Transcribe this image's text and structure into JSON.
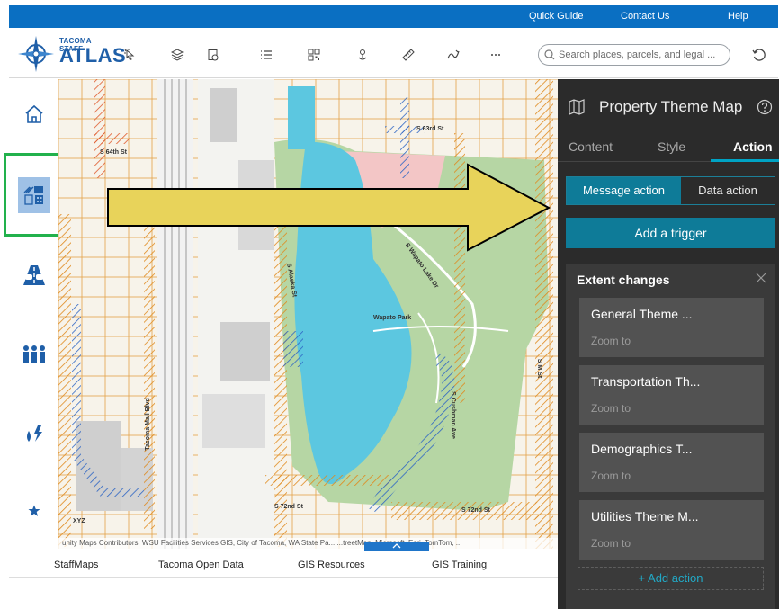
{
  "topbar": {
    "links": [
      "Quick Guide",
      "Contact Us",
      "Help"
    ]
  },
  "header": {
    "logo_small": "TACOMA STAFF",
    "logo_big": "ATLAS",
    "search_placeholder": "Search places, parcels, and legal ...",
    "tools": [
      "select-tool-icon",
      "layers-icon",
      "legend-icon",
      "list-icon",
      "qr-code-icon",
      "pin-icon",
      "measure-icon",
      "draw-icon",
      "more-icon"
    ]
  },
  "sidebar": {
    "items": [
      "home-icon",
      "property-theme-icon",
      "transportation-theme-icon",
      "demographics-theme-icon",
      "utilities-theme-icon",
      "favorites-icon"
    ]
  },
  "map": {
    "labels": {
      "s64th": "S 64th St",
      "s63rd": "S 63rd St",
      "wapato_park": "Wapato Park",
      "wapato_lake": "S Wapato Lake Dr",
      "cushman": "S Cushman Ave",
      "alaska": "S Alaska St",
      "s72nd": "S 72nd St",
      "s72nd_b": "S 72nd St",
      "sm_st": "S M St",
      "tacoma_mall": "Tacoma Mall Blvd",
      "xyz": "XYZ"
    },
    "attribution": "unity Maps Contributors, WSU Facilities Services GIS, City of Tacoma, WA State Pa... ...treetMap, Microsoft, Esri, TomTom, ..."
  },
  "footer": {
    "links": [
      "StaffMaps",
      "Tacoma Open Data",
      "GIS Resources",
      "GIS Training"
    ]
  },
  "panel": {
    "title": "Property Theme Map",
    "tabs": [
      "Content",
      "Style",
      "Action"
    ],
    "active_tab": "Action",
    "segment": {
      "left": "Message action",
      "right": "Data action"
    },
    "trigger_button": "Add a trigger",
    "extent_title": "Extent changes",
    "actions": [
      {
        "title": "General Theme ...",
        "sub": "Zoom to"
      },
      {
        "title": "Transportation Th...",
        "sub": "Zoom to"
      },
      {
        "title": "Demographics T...",
        "sub": "Zoom to"
      },
      {
        "title": "Utilities Theme M...",
        "sub": "Zoom to"
      }
    ],
    "add_action": "+ Add action"
  },
  "colors": {
    "brand_blue": "#0a6fc2",
    "teal": "#0e7b98",
    "highlight_green": "#22b14c",
    "arrow_fill": "#e8d35a"
  }
}
